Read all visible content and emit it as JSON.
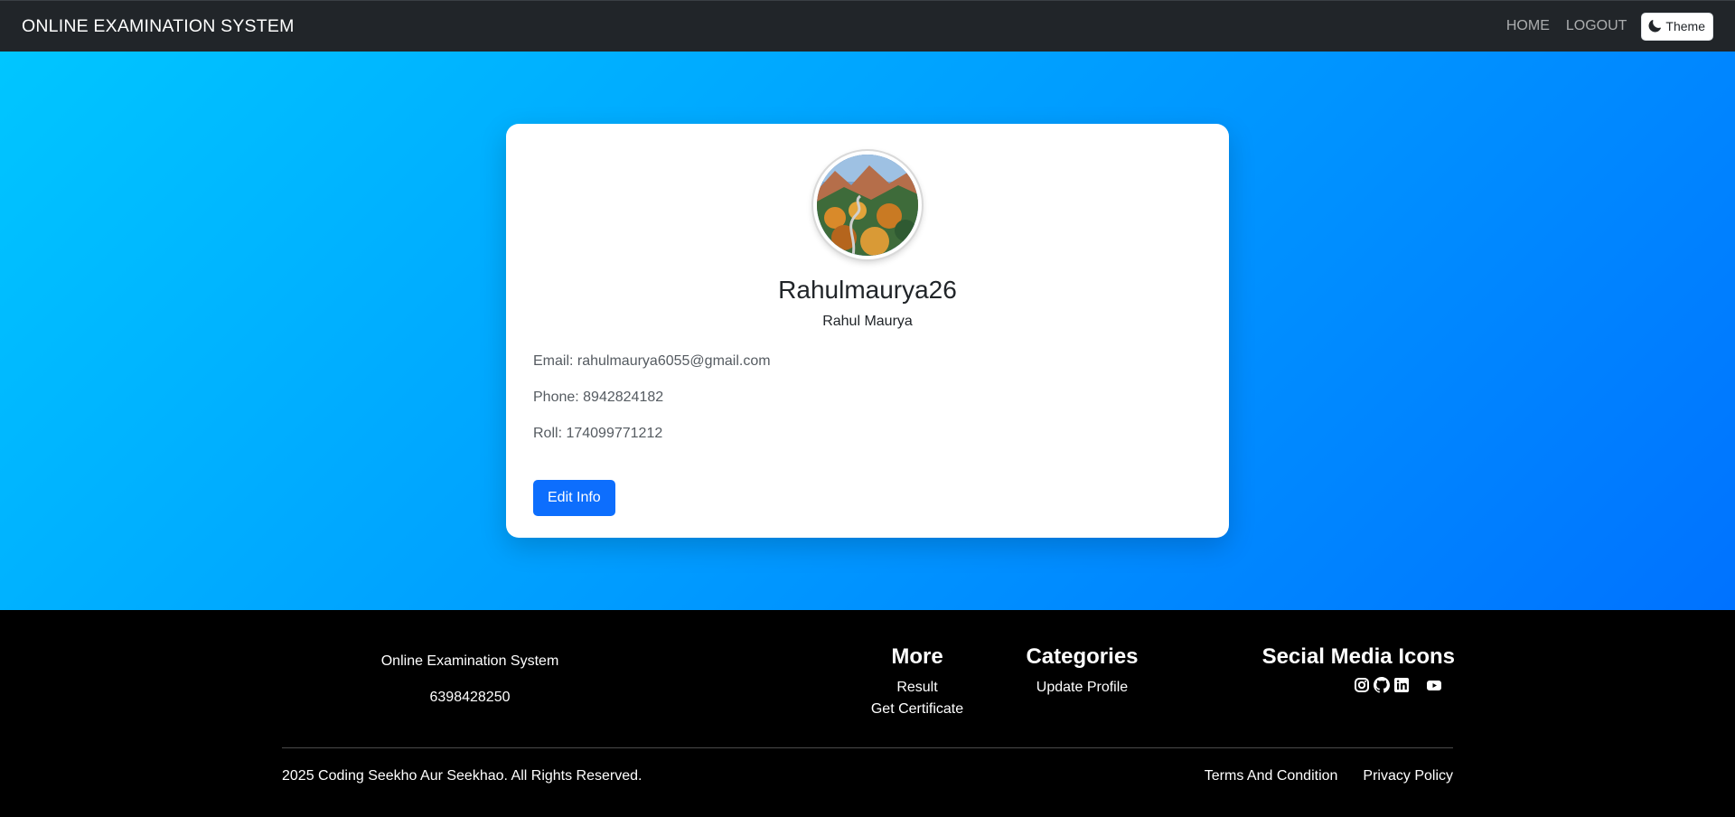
{
  "navbar": {
    "brand": "ONLINE EXAMINATION SYSTEM",
    "links": [
      "HOME",
      "LOGOUT"
    ],
    "theme_label": "Theme"
  },
  "profile": {
    "username": "Rahulmaurya26",
    "full_name": "Rahul Maurya",
    "email_line": "Email: rahulmaurya6055@gmail.com",
    "phone_line": "Phone: 8942824182",
    "roll_line": "Roll: 174099771212",
    "edit_label": "Edit Info"
  },
  "footer": {
    "site_name": "Online Examination System",
    "phone": "6398428250",
    "more_heading": "More",
    "more_links": [
      "Result",
      "Get Certificate"
    ],
    "categories_heading": "Categories",
    "category_links": [
      "Update Profile"
    ],
    "social_heading": "Secial Media Icons",
    "social_icons": [
      "instagram-icon",
      "github-icon",
      "linkedin-icon",
      "youtube-icon"
    ],
    "copyright": "2025 Coding Seekho Aur Seekhao. All Rights Reserved.",
    "bottom_links": [
      "Terms And Condition",
      "Privacy Policy"
    ]
  },
  "colors": {
    "navbar_bg": "#212529",
    "gradient_start": "#00c6ff",
    "gradient_end": "#0072ff",
    "primary_button": "#0d6efd",
    "footer_bg": "#000000"
  }
}
